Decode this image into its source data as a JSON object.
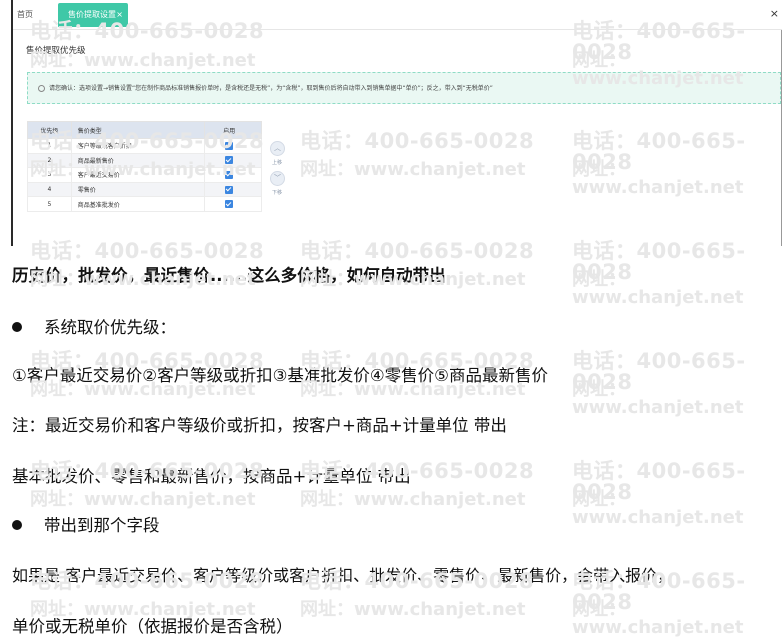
{
  "window": {
    "tab_home": "首页",
    "tab_active": "售价提取设置",
    "tab_close": "×",
    "window_close": "×"
  },
  "section_title": "售价提取优先级",
  "notice_text": "请您确认：选项设置→销售设置“您在制作商品标准销售报价单时，是含税还是无税”，为“含税”，取到售价后将自动带入到销售单据中“单价”；反之，带入到“无税单价”",
  "table": {
    "headers": [
      "优先级",
      "售价类型",
      "启用"
    ],
    "rows": [
      {
        "priority": "1",
        "type": "客户等级或客户折扣",
        "enabled": true
      },
      {
        "priority": "2",
        "type": "商品最新售价",
        "enabled": true
      },
      {
        "priority": "3",
        "type": "客户最近交易价",
        "enabled": true
      },
      {
        "priority": "4",
        "type": "零售价",
        "enabled": true
      },
      {
        "priority": "5",
        "type": "商品基准批发价",
        "enabled": true
      }
    ]
  },
  "move_up_label": "上移",
  "move_down_label": "下移",
  "watermark": {
    "tel": "电话：400-665-0028",
    "web": "网址：www.chanjet.net"
  },
  "article": {
    "heading": "历史价，批发价，最近售价......这么多价格，如何自动带出",
    "bullet1": "系统取价优先级：",
    "line_order": "①客户最近交易价②客户等级或折扣③基准批发价④零售价⑤商品最新售价",
    "line_note1": "注：最近交易价和客户等级价或折扣，按客户+商品+计量单位 带出",
    "line_note2": "基本批发价、零售和最新售价，按商品+计量单位 带出",
    "bullet2": "带出到那个字段",
    "line_field1": "如果是 客户最近交易价、客户等级价或客户折扣、批发价、零售价、最新售价，会带入报价，",
    "line_field2": "单价或无税单价（依据报价是否含税）"
  },
  "colors": {
    "tab_active": "#3fc8a7",
    "checkbox": "#3b86e0",
    "table_header": "#dde4ef",
    "notice_bg": "#eaf8f3"
  }
}
